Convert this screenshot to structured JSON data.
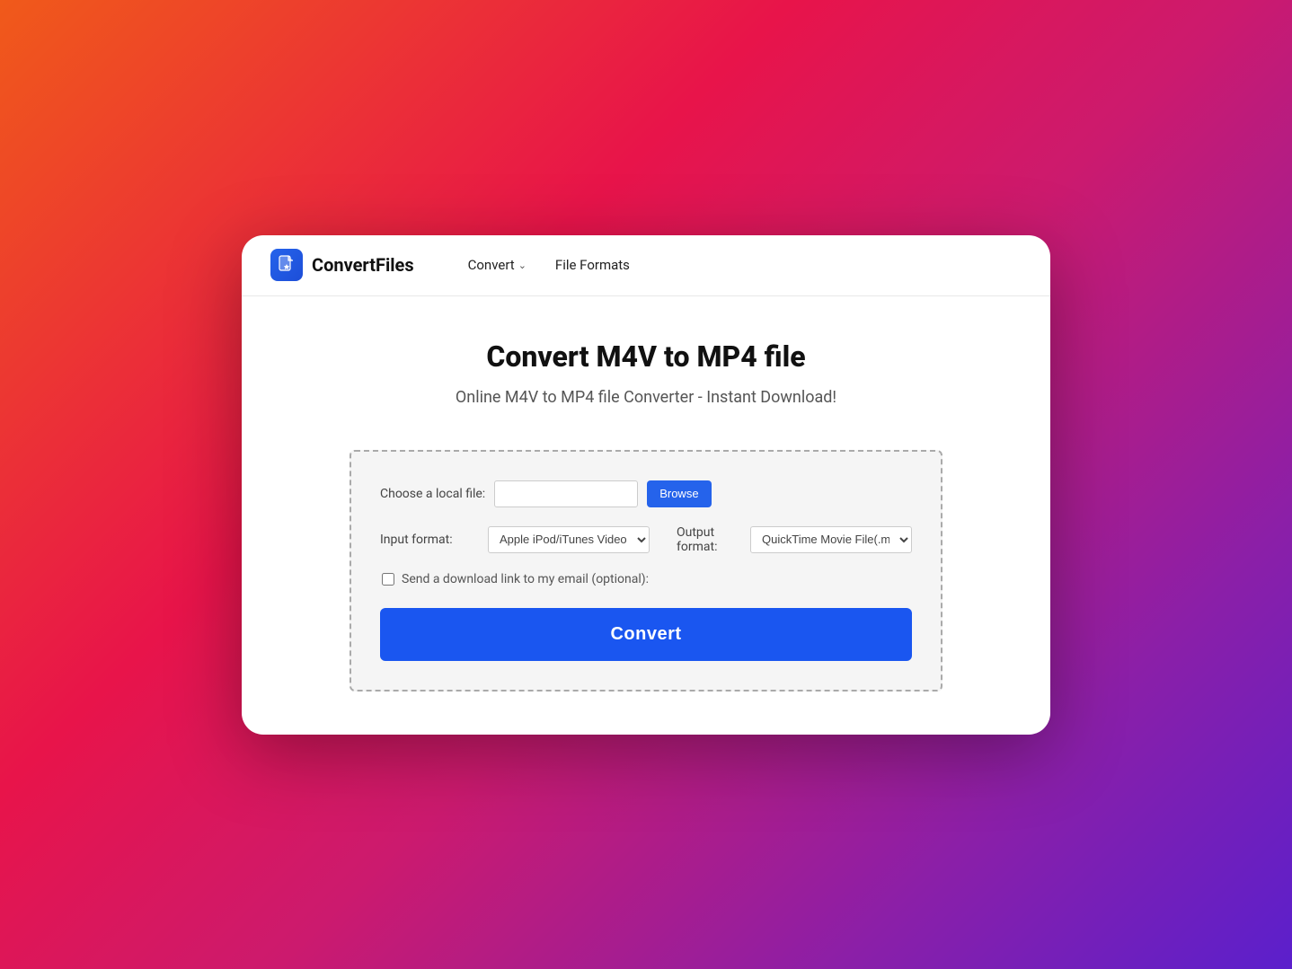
{
  "page": {
    "background": "gradient orange-to-purple"
  },
  "navbar": {
    "logo_text": "ConvertFiles",
    "nav_items": [
      {
        "label": "Convert",
        "has_dropdown": true
      },
      {
        "label": "File Formats",
        "has_dropdown": false
      }
    ]
  },
  "main": {
    "title": "Convert M4V to MP4 file",
    "subtitle": "Online M4V to MP4 file Converter - Instant Download!",
    "form": {
      "choose_file_label": "Choose a local file:",
      "browse_button_label": "Browse",
      "input_format_label": "Input format:",
      "input_format_value": "Apple iPod/iTunes Video File(.m",
      "output_format_label": "Output format:",
      "output_format_value": "QuickTime Movie File(.mov)",
      "email_checkbox_label": "Send a download link to my email (optional):",
      "convert_button_label": "Convert"
    }
  }
}
